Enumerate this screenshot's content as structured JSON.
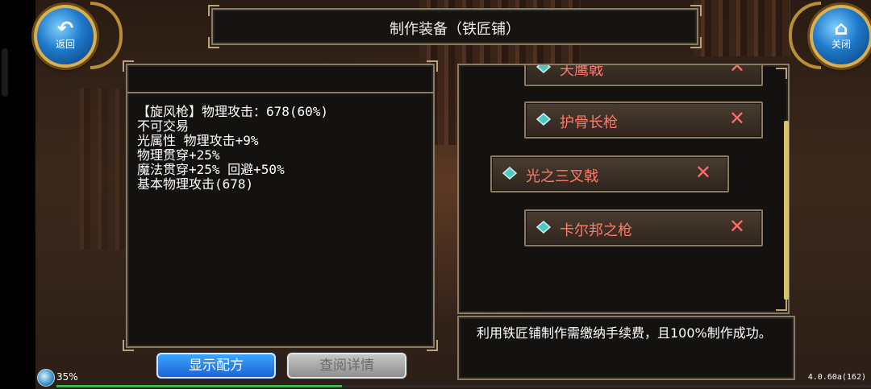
{
  "header": {
    "title": "制作装备（铁匠铺）",
    "back_label": "返回",
    "close_label": "关闭"
  },
  "item_detail": {
    "lines": [
      "【旋风枪】物理攻击：678(60%)",
      "不可交易",
      "光属性 物理攻击+9%",
      "物理贯穿+25%",
      "魔法贯穿+25% 回避+50%",
      "基本物理攻击(678)"
    ]
  },
  "recipe_list": {
    "items": [
      {
        "name": "天鹰戟",
        "status_icon": "x-icon",
        "selected": false
      },
      {
        "name": "护骨长枪",
        "status_icon": "x-icon",
        "selected": false
      },
      {
        "name": "光之三叉戟",
        "status_icon": "x-icon",
        "selected": true
      },
      {
        "name": "卡尔邦之枪",
        "status_icon": "x-icon",
        "selected": false
      }
    ]
  },
  "info": {
    "text": "利用铁匠铺制作需缴纳手续费，且100%制作成功。"
  },
  "buttons": {
    "show_recipe": "显示配方",
    "view_details": "查阅详情"
  },
  "status": {
    "battery": "35%",
    "battery_fraction": 0.35,
    "version": "4.0.60a(162)"
  },
  "colors": {
    "recipe_name": "#ff7a6a",
    "x_mark": "#ff6b6b",
    "accent_blue": "#1d62d6",
    "frame_gold": "#d8b052"
  }
}
